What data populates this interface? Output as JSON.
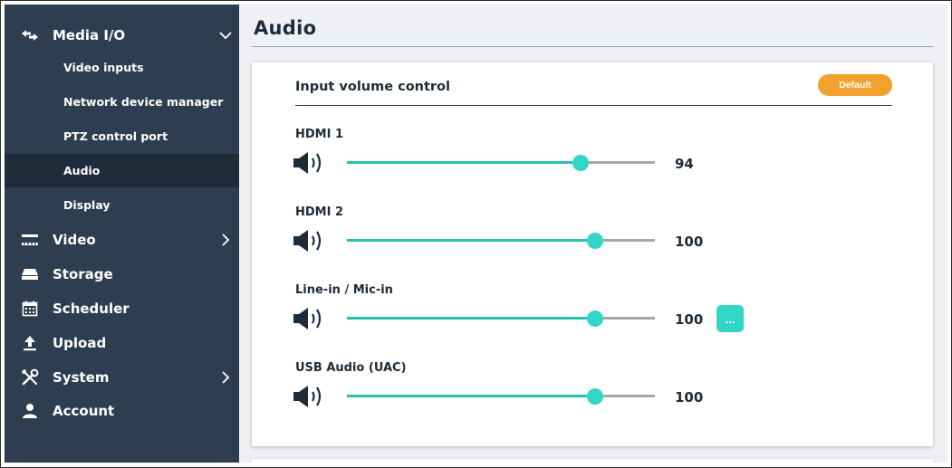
{
  "sidebar": {
    "media_io": {
      "label": "Media I/O",
      "icon": "arrows-exchange-icon",
      "expanded": true
    },
    "media_items": [
      {
        "label": "Video inputs"
      },
      {
        "label": "Network device manager"
      },
      {
        "label": "PTZ control port"
      },
      {
        "label": "Audio",
        "active": true
      },
      {
        "label": "Display"
      }
    ],
    "items": [
      {
        "label": "Video",
        "icon": "film-icon",
        "has_chevron": true
      },
      {
        "label": "Storage",
        "icon": "drive-icon",
        "has_chevron": false
      },
      {
        "label": "Scheduler",
        "icon": "calendar-icon",
        "has_chevron": false
      },
      {
        "label": "Upload",
        "icon": "upload-icon",
        "has_chevron": false
      },
      {
        "label": "System",
        "icon": "tools-icon",
        "has_chevron": true
      },
      {
        "label": "Account",
        "icon": "user-icon",
        "has_chevron": false
      }
    ]
  },
  "main": {
    "title": "Audio",
    "section_title": "Input volume control",
    "default_button": "Default",
    "more_button": "...",
    "channels": [
      {
        "label": "HDMI 1",
        "value": "94",
        "level": 0.76
      },
      {
        "label": "HDMI 2",
        "value": "100",
        "level": 0.805
      },
      {
        "label": "Line-in / Mic-in",
        "value": "100",
        "level": 0.805,
        "has_more": true
      },
      {
        "label": "USB Audio (UAC)",
        "value": "100",
        "level": 0.805
      }
    ]
  },
  "colors": {
    "sidebar_bg": "#2d3e50",
    "sidebar_active": "#1f2d3b",
    "accent_teal": "#31d6c6",
    "accent_orange": "#f2a12e",
    "content_bg": "#eef0f3"
  }
}
